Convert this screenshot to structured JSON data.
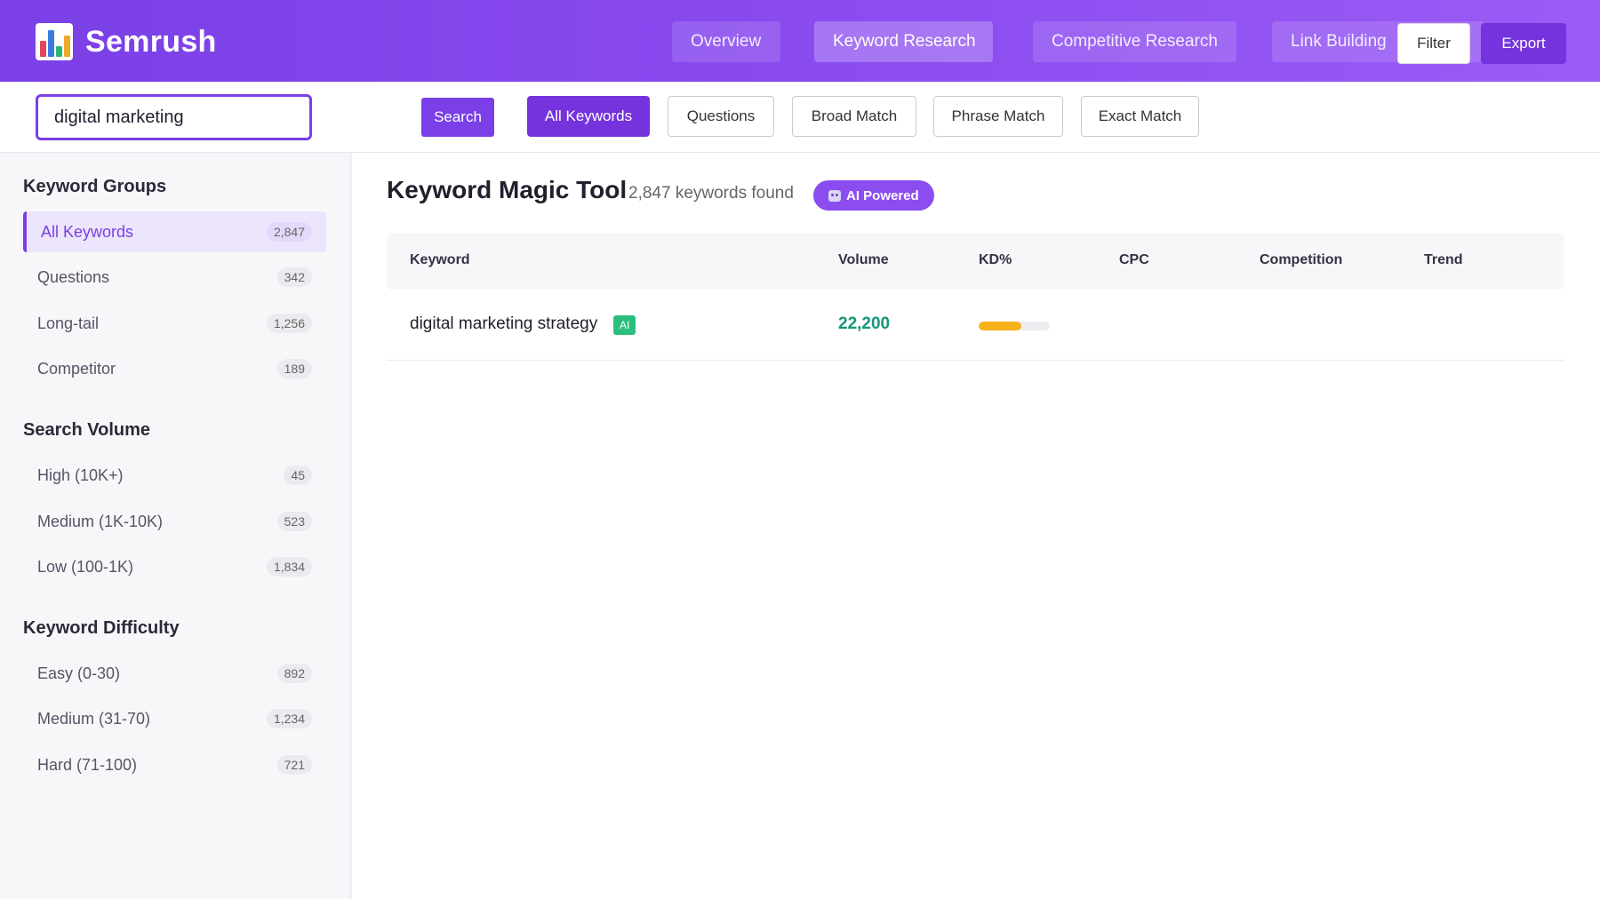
{
  "app": {
    "name": "Semrush"
  },
  "nav": {
    "tabs": [
      {
        "label": "Overview"
      },
      {
        "label": "Keyword Research"
      },
      {
        "label": "Competitive Research"
      },
      {
        "label": "Link Building"
      }
    ],
    "filter_label": "Filter",
    "export_label": "Export"
  },
  "search": {
    "value": "digital marketing",
    "button_label": "Search",
    "chips": [
      {
        "label": "All Keywords"
      },
      {
        "label": "Questions"
      },
      {
        "label": "Broad Match"
      },
      {
        "label": "Phrase Match"
      },
      {
        "label": "Exact Match"
      }
    ]
  },
  "sidebar": {
    "sections": [
      {
        "title": "Keyword Groups",
        "items": [
          {
            "label": "All Keywords",
            "count": "2,847"
          },
          {
            "label": "Questions",
            "count": "342"
          },
          {
            "label": "Long-tail",
            "count": "1,256"
          },
          {
            "label": "Competitor",
            "count": "189"
          }
        ]
      },
      {
        "title": "Search Volume",
        "items": [
          {
            "label": "High (10K+)",
            "count": "45"
          },
          {
            "label": "Medium (1K-10K)",
            "count": "523"
          },
          {
            "label": "Low (100-1K)",
            "count": "1,834"
          }
        ]
      },
      {
        "title": "Keyword Difficulty",
        "items": [
          {
            "label": "Easy (0-30)",
            "count": "892"
          },
          {
            "label": "Medium (31-70)",
            "count": "1,234"
          },
          {
            "label": "Hard (71-100)",
            "count": "721"
          }
        ]
      }
    ]
  },
  "main": {
    "title": "Keyword Magic Tool",
    "found": "2,847 keywords found",
    "ai_badge": "AI Powered",
    "columns": [
      "Keyword",
      "Volume",
      "KD%",
      "CPC",
      "Competition",
      "Trend"
    ],
    "rows": [
      {
        "keyword": "digital marketing strategy",
        "tag": "AI",
        "volume": "22,200",
        "kd_level": 0.6
      }
    ]
  },
  "colors": {
    "brand_purple": "#7a3fe6",
    "volume_green": "#16967a",
    "kd_yellow": "#f5b21b",
    "ai_tag_green": "#2bbf7f"
  }
}
